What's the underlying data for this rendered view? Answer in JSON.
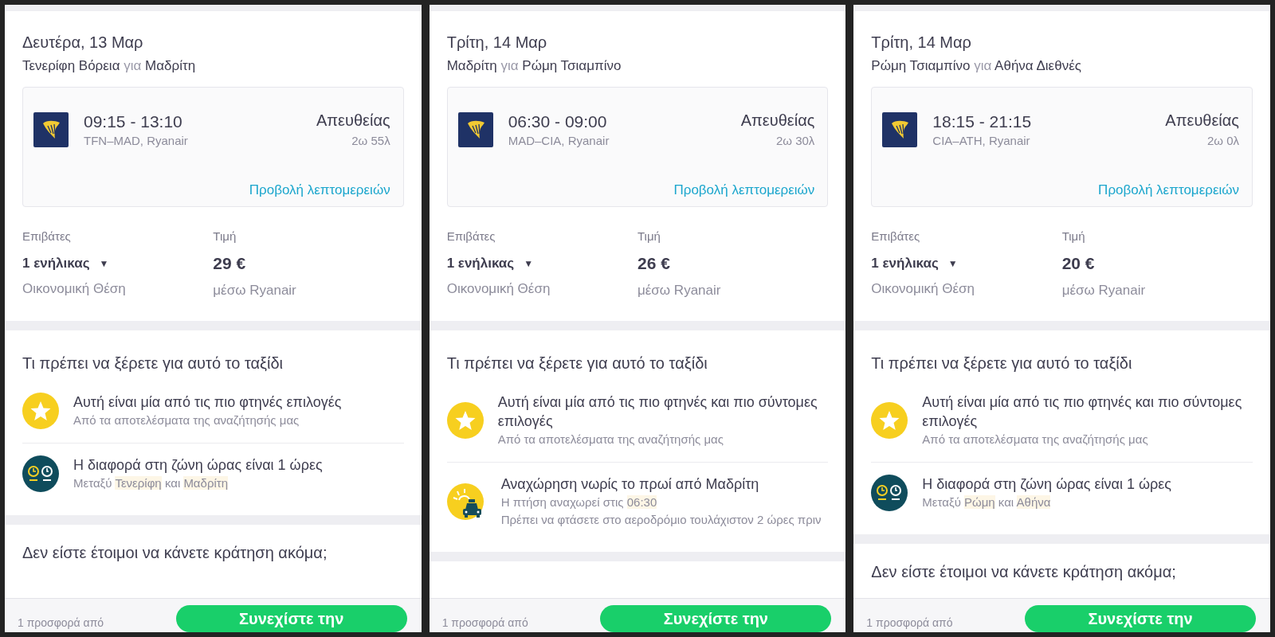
{
  "panels": [
    {
      "date": "Δευτέρα, 13 Μαρ",
      "route": {
        "from": "Τενερίφη Βόρεια",
        "joiner": "για",
        "to": "Μαδρίτη"
      },
      "flight": {
        "times": "09:15 - 13:10",
        "codes": "TFN–MAD, Ryanair",
        "stops": "Απευθείας",
        "duration": "2ω 55λ",
        "details_link": "Προβολή λεπτομερειών"
      },
      "passengers": {
        "label": "Επιβάτες",
        "value": "1 ενήλικας",
        "caret": "▼",
        "cabin": "Οικονομική Θέση"
      },
      "price": {
        "label": "Τιμή",
        "value": "29 €",
        "via": "μέσω Ryanair"
      },
      "info_title": "Τι πρέπει να ξέρετε για αυτό το ταξίδι",
      "tips": [
        {
          "kind": "star",
          "title": "Αυτή είναι μία από τις πιο φτηνές επιλογές",
          "sub": [
            [
              {
                "text": "Από τα αποτελέσματα της αναζήτησής μας",
                "highlight": false
              }
            ]
          ]
        },
        {
          "kind": "clock",
          "title": "Η διαφορά στη ζώνη ώρας είναι 1 ώρες",
          "sub": [
            [
              {
                "text": "Μεταξύ ",
                "highlight": false
              },
              {
                "text": "Τενερίφη",
                "highlight": true
              },
              {
                "text": " και ",
                "highlight": false
              },
              {
                "text": "Μαδρίτη",
                "highlight": true
              }
            ]
          ]
        }
      ],
      "not_ready_title": "Δεν είστε έτοιμοι να κάνετε κράτηση ακόμα;",
      "offer_text": "1 προσφορά από",
      "continue_button": "Συνεχίστε την"
    },
    {
      "date": "Τρίτη, 14 Μαρ",
      "route": {
        "from": "Μαδρίτη",
        "joiner": "για",
        "to": "Ρώμη Τσιαμπίνο"
      },
      "flight": {
        "times": "06:30 - 09:00",
        "codes": "MAD–CIA, Ryanair",
        "stops": "Απευθείας",
        "duration": "2ω 30λ",
        "details_link": "Προβολή λεπτομερειών"
      },
      "passengers": {
        "label": "Επιβάτες",
        "value": "1 ενήλικας",
        "caret": "▼",
        "cabin": "Οικονομική Θέση"
      },
      "price": {
        "label": "Τιμή",
        "value": "26 €",
        "via": "μέσω Ryanair"
      },
      "info_title": "Τι πρέπει να ξέρετε για αυτό το ταξίδι",
      "tips": [
        {
          "kind": "star",
          "title": "Αυτή είναι μία από τις πιο φτηνές και πιο σύντομες επιλογές",
          "sub": [
            [
              {
                "text": "Από τα αποτελέσματα της αναζήτησής μας",
                "highlight": false
              }
            ]
          ]
        },
        {
          "kind": "taxi",
          "title": "Αναχώρηση νωρίς το πρωί από Μαδρίτη",
          "sub": [
            [
              {
                "text": "Η πτήση αναχωρεί στις ",
                "highlight": false
              },
              {
                "text": "06:30",
                "highlight": true
              }
            ],
            [
              {
                "text": "Πρέπει να φτάσετε στο αεροδρόμιο τουλάχιστον 2 ώρες πριν",
                "highlight": false
              }
            ]
          ]
        }
      ],
      "offer_text": "1 προσφορά από",
      "continue_button": "Συνεχίστε την"
    },
    {
      "date": "Τρίτη, 14 Μαρ",
      "route": {
        "from": "Ρώμη Τσιαμπίνο",
        "joiner": "για",
        "to": "Αθήνα Διεθνές"
      },
      "flight": {
        "times": "18:15 - 21:15",
        "codes": "CIA–ATH, Ryanair",
        "stops": "Απευθείας",
        "duration": "2ω 0λ",
        "details_link": "Προβολή λεπτομερειών"
      },
      "passengers": {
        "label": "Επιβάτες",
        "value": "1 ενήλικας",
        "caret": "▼",
        "cabin": "Οικονομική Θέση"
      },
      "price": {
        "label": "Τιμή",
        "value": "20 €",
        "via": "μέσω Ryanair"
      },
      "info_title": "Τι πρέπει να ξέρετε για αυτό το ταξίδι",
      "tips": [
        {
          "kind": "star",
          "title": "Αυτή είναι μία από τις πιο φτηνές και πιο σύντομες επιλογές",
          "sub": [
            [
              {
                "text": "Από τα αποτελέσματα της αναζήτησής μας",
                "highlight": false
              }
            ]
          ]
        },
        {
          "kind": "clock",
          "title": "Η διαφορά στη ζώνη ώρας είναι 1 ώρες",
          "sub": [
            [
              {
                "text": "Μεταξύ ",
                "highlight": false
              },
              {
                "text": "Ρώμη",
                "highlight": true
              },
              {
                "text": " και ",
                "highlight": false
              },
              {
                "text": "Αθήνα",
                "highlight": true
              }
            ]
          ]
        }
      ],
      "not_ready_title": "Δεν είστε έτοιμοι να κάνετε κράτηση ακόμα;",
      "offer_text": "1 προσφορά από",
      "continue_button": "Συνεχίστε την"
    }
  ]
}
